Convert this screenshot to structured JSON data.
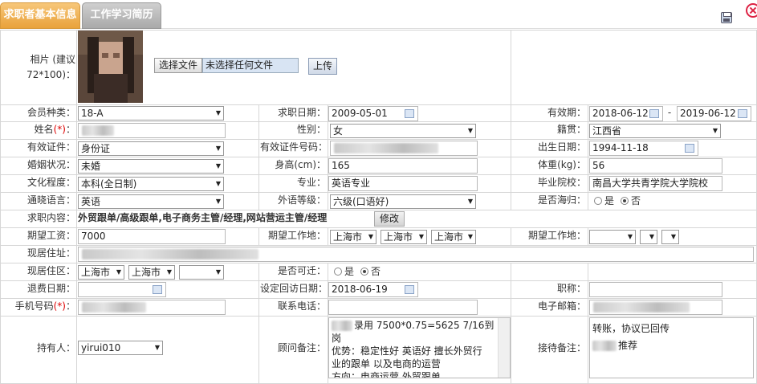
{
  "tabs": [
    {
      "label": "求职者基本信息"
    },
    {
      "label": "工作学习简历"
    }
  ],
  "photo": {
    "label": "相片 (建议72*100)：",
    "choose_button": "选择文件",
    "no_file": "未选择任何文件",
    "upload_button": "上传"
  },
  "row1": {
    "member_label": "会员种类：",
    "member_value": "18-A",
    "apply_date_label": "求职日期：",
    "apply_date": "2009-05-01",
    "valid_label": "有效期：",
    "valid_from": "2018-06-12",
    "valid_sep": "-",
    "valid_to": "2019-06-12"
  },
  "row2": {
    "name_label": "姓名",
    "required_mark": "(*)",
    "colon": "：",
    "gender_label": "性别：",
    "gender_value": "女",
    "origin_label": "籍贯：",
    "origin_value": "江西省"
  },
  "row3": {
    "id_type_label": "有效证件：",
    "id_type_value": "身份证",
    "id_no_label": "有效证件号码：",
    "birth_label": "出生日期：",
    "birth_value": "1994-11-18"
  },
  "row4": {
    "marital_label": "婚姻状况：",
    "marital_value": "未婚",
    "height_label": "身高(cm)：",
    "height_value": "165",
    "weight_label": "体重(kg)：",
    "weight_value": "56"
  },
  "row5": {
    "edu_label": "文化程度：",
    "edu_value": "本科(全日制)",
    "major_label": "专业：",
    "major_value": "英语专业",
    "school_label": "毕业院校：",
    "school_value": "南昌大学共青学院大学院校"
  },
  "row6": {
    "lang_label": "通晓语言：",
    "lang_value": "英语",
    "lang_level_label": "外语等级：",
    "lang_level_value": "六级(口语好)",
    "overseas_label": "是否海归：",
    "yes": "是",
    "no": "否"
  },
  "row7": {
    "content_label": "求职内容：",
    "content_value": "外贸跟单/高级跟单,电子商务主管/经理,网站营运主管/经理",
    "modify_button": "修改"
  },
  "row8": {
    "salary_label": "期望工资：",
    "salary_value": "7000",
    "work_place_label": "期望工作地：",
    "wp1": "上海市",
    "wp2": "上海市",
    "wp3": "上海市",
    "work_place2_label": "期望工作地："
  },
  "row9": {
    "address_label": "现居住址："
  },
  "row10": {
    "residence_label": "现居住区：",
    "r1": "上海市",
    "r2": "上海市",
    "accessible_label": "是否可迁：",
    "yes": "是",
    "no": "否"
  },
  "row11": {
    "refund_label": "退费日期：",
    "visit_label": "设定回访日期：",
    "visit_value": "2018-06-19",
    "title_label": "职称："
  },
  "row12": {
    "mobile_label": "手机号码",
    "required_mark": "(*)",
    "colon": "：",
    "phone_label": "联系电话：",
    "email_label": "电子邮箱："
  },
  "row13": {
    "holder_label": "持有人：",
    "holder_value": "yirui010",
    "advisor_label": "顾问备注：",
    "advisor_lines": [
      "录用  7500*0.75=5625  7/16到",
      "岗",
      "优势：稳定性好 英语好 擅长外贸行",
      "业的跟单 以及电商的运营",
      "方向：电商运营 外贸跟单"
    ],
    "reception_label": "接待备注：",
    "reception_lines": [
      "转账，协议已回传",
      "推荐"
    ]
  },
  "colors": {
    "tab_active": "#e9a23b",
    "tab_idle": "#a9a9a9",
    "border": "#d6d6d6"
  }
}
